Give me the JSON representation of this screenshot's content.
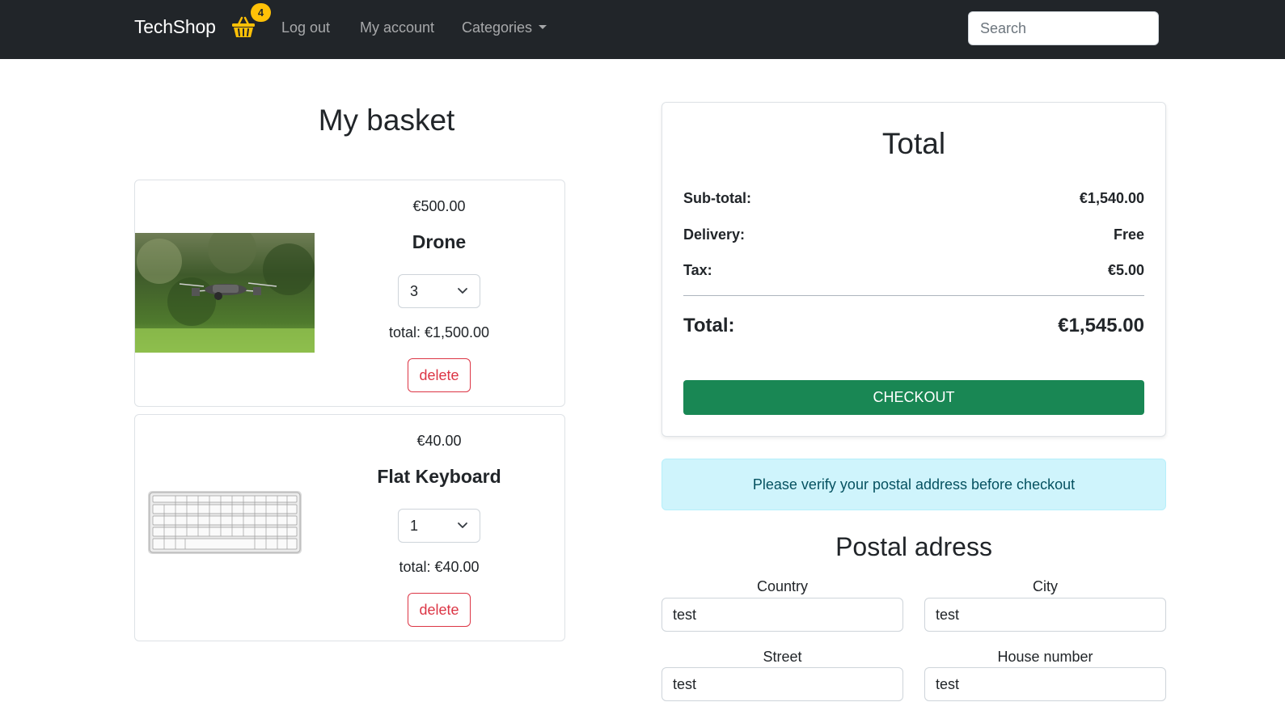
{
  "navbar": {
    "brand": "TechShop",
    "basket_icon": "basket-icon",
    "basket_count": "4",
    "links": {
      "logout": "Log out",
      "account": "My account",
      "categories": "Categories"
    },
    "search_placeholder": "Search"
  },
  "basket": {
    "title": "My basket",
    "items": [
      {
        "unit_price": "€500.00",
        "name": "Drone",
        "quantity": "3",
        "total": "total: €1,500.00",
        "delete_label": "delete",
        "image": "drone-photo"
      },
      {
        "unit_price": "€40.00",
        "name": "Flat Keyboard",
        "quantity": "1",
        "total": "total: €40.00",
        "delete_label": "delete",
        "image": "keyboard-photo"
      }
    ]
  },
  "summary": {
    "title": "Total",
    "subtotal_label": "Sub-total:",
    "subtotal_value": "€1,540.00",
    "delivery_label": "Delivery:",
    "delivery_value": "Free",
    "tax_label": "Tax:",
    "tax_value": "€5.00",
    "total_label": "Total:",
    "total_value": "€1,545.00",
    "checkout_label": "CHECKOUT"
  },
  "alert": {
    "message": "Please verify your postal address before checkout"
  },
  "postal": {
    "title": "Postal adress",
    "country_label": "Country",
    "country_value": "test",
    "city_label": "City",
    "city_value": "test",
    "street_label": "Street",
    "street_value": "test",
    "house_label": "House number",
    "house_value": "test"
  },
  "colors": {
    "navbar": "#212529",
    "badge": "#ffc107",
    "checkout": "#198754",
    "delete": "#dc3545",
    "alert_bg": "#cff4fc",
    "alert_text": "#055160"
  }
}
